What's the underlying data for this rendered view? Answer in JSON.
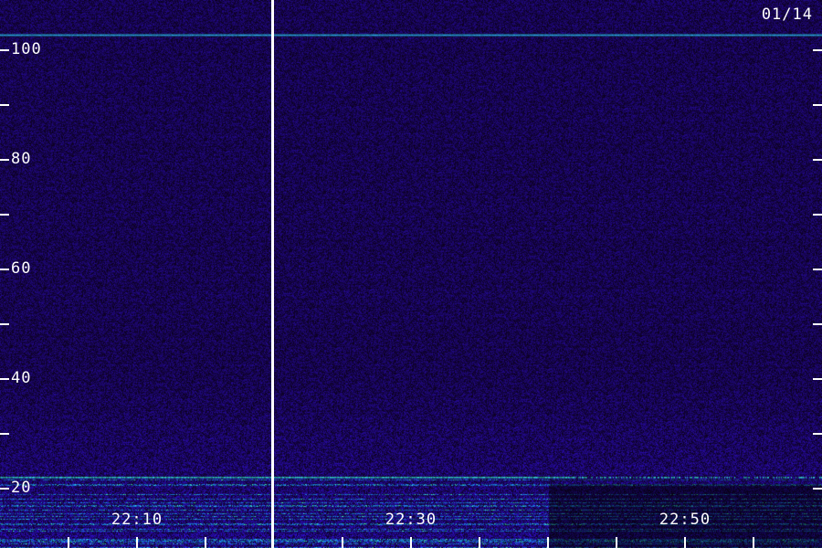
{
  "spectrogram": {
    "date_label": "01/14",
    "y_axis": {
      "labeled_ticks": [
        {
          "value": 100,
          "text": "100"
        },
        {
          "value": 80,
          "text": "80"
        },
        {
          "value": 60,
          "text": "60"
        },
        {
          "value": 40,
          "text": "40"
        },
        {
          "value": 20,
          "text": "20"
        }
      ],
      "minor_ticks": [
        90,
        70,
        50,
        30
      ],
      "range": [
        12,
        108
      ]
    },
    "x_axis": {
      "labeled_ticks": [
        {
          "value": "22:10",
          "text": "22:10"
        },
        {
          "value": "22:30",
          "text": "22:30"
        },
        {
          "value": "22:50",
          "text": "22:50"
        }
      ],
      "minor_tick_step_minutes": 5
    },
    "colors": {
      "background": "#000000",
      "noise": "#3a1aa8",
      "signal_line": "#3fb8ff",
      "hot": "#40ffd0",
      "axis": "#ffffff"
    }
  }
}
